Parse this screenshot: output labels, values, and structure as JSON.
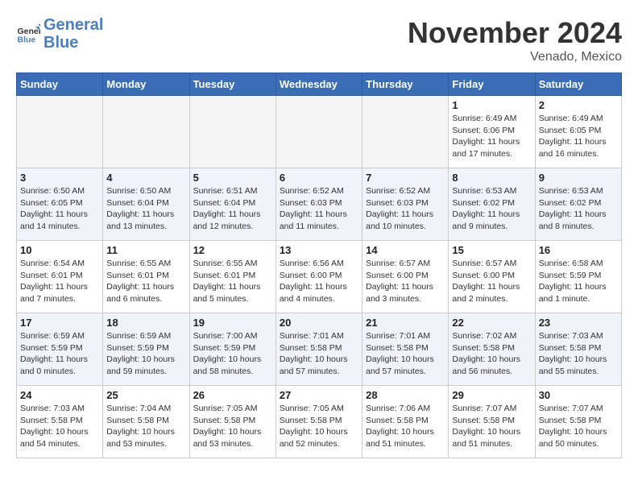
{
  "header": {
    "logo_general": "General",
    "logo_blue": "Blue",
    "month_title": "November 2024",
    "location": "Venado, Mexico"
  },
  "weekdays": [
    "Sunday",
    "Monday",
    "Tuesday",
    "Wednesday",
    "Thursday",
    "Friday",
    "Saturday"
  ],
  "weeks": [
    [
      {
        "day": "",
        "info": ""
      },
      {
        "day": "",
        "info": ""
      },
      {
        "day": "",
        "info": ""
      },
      {
        "day": "",
        "info": ""
      },
      {
        "day": "",
        "info": ""
      },
      {
        "day": "1",
        "info": "Sunrise: 6:49 AM\nSunset: 6:06 PM\nDaylight: 11 hours and 17 minutes."
      },
      {
        "day": "2",
        "info": "Sunrise: 6:49 AM\nSunset: 6:05 PM\nDaylight: 11 hours and 16 minutes."
      }
    ],
    [
      {
        "day": "3",
        "info": "Sunrise: 6:50 AM\nSunset: 6:05 PM\nDaylight: 11 hours and 14 minutes."
      },
      {
        "day": "4",
        "info": "Sunrise: 6:50 AM\nSunset: 6:04 PM\nDaylight: 11 hours and 13 minutes."
      },
      {
        "day": "5",
        "info": "Sunrise: 6:51 AM\nSunset: 6:04 PM\nDaylight: 11 hours and 12 minutes."
      },
      {
        "day": "6",
        "info": "Sunrise: 6:52 AM\nSunset: 6:03 PM\nDaylight: 11 hours and 11 minutes."
      },
      {
        "day": "7",
        "info": "Sunrise: 6:52 AM\nSunset: 6:03 PM\nDaylight: 11 hours and 10 minutes."
      },
      {
        "day": "8",
        "info": "Sunrise: 6:53 AM\nSunset: 6:02 PM\nDaylight: 11 hours and 9 minutes."
      },
      {
        "day": "9",
        "info": "Sunrise: 6:53 AM\nSunset: 6:02 PM\nDaylight: 11 hours and 8 minutes."
      }
    ],
    [
      {
        "day": "10",
        "info": "Sunrise: 6:54 AM\nSunset: 6:01 PM\nDaylight: 11 hours and 7 minutes."
      },
      {
        "day": "11",
        "info": "Sunrise: 6:55 AM\nSunset: 6:01 PM\nDaylight: 11 hours and 6 minutes."
      },
      {
        "day": "12",
        "info": "Sunrise: 6:55 AM\nSunset: 6:01 PM\nDaylight: 11 hours and 5 minutes."
      },
      {
        "day": "13",
        "info": "Sunrise: 6:56 AM\nSunset: 6:00 PM\nDaylight: 11 hours and 4 minutes."
      },
      {
        "day": "14",
        "info": "Sunrise: 6:57 AM\nSunset: 6:00 PM\nDaylight: 11 hours and 3 minutes."
      },
      {
        "day": "15",
        "info": "Sunrise: 6:57 AM\nSunset: 6:00 PM\nDaylight: 11 hours and 2 minutes."
      },
      {
        "day": "16",
        "info": "Sunrise: 6:58 AM\nSunset: 5:59 PM\nDaylight: 11 hours and 1 minute."
      }
    ],
    [
      {
        "day": "17",
        "info": "Sunrise: 6:59 AM\nSunset: 5:59 PM\nDaylight: 11 hours and 0 minutes."
      },
      {
        "day": "18",
        "info": "Sunrise: 6:59 AM\nSunset: 5:59 PM\nDaylight: 10 hours and 59 minutes."
      },
      {
        "day": "19",
        "info": "Sunrise: 7:00 AM\nSunset: 5:59 PM\nDaylight: 10 hours and 58 minutes."
      },
      {
        "day": "20",
        "info": "Sunrise: 7:01 AM\nSunset: 5:58 PM\nDaylight: 10 hours and 57 minutes."
      },
      {
        "day": "21",
        "info": "Sunrise: 7:01 AM\nSunset: 5:58 PM\nDaylight: 10 hours and 57 minutes."
      },
      {
        "day": "22",
        "info": "Sunrise: 7:02 AM\nSunset: 5:58 PM\nDaylight: 10 hours and 56 minutes."
      },
      {
        "day": "23",
        "info": "Sunrise: 7:03 AM\nSunset: 5:58 PM\nDaylight: 10 hours and 55 minutes."
      }
    ],
    [
      {
        "day": "24",
        "info": "Sunrise: 7:03 AM\nSunset: 5:58 PM\nDaylight: 10 hours and 54 minutes."
      },
      {
        "day": "25",
        "info": "Sunrise: 7:04 AM\nSunset: 5:58 PM\nDaylight: 10 hours and 53 minutes."
      },
      {
        "day": "26",
        "info": "Sunrise: 7:05 AM\nSunset: 5:58 PM\nDaylight: 10 hours and 53 minutes."
      },
      {
        "day": "27",
        "info": "Sunrise: 7:05 AM\nSunset: 5:58 PM\nDaylight: 10 hours and 52 minutes."
      },
      {
        "day": "28",
        "info": "Sunrise: 7:06 AM\nSunset: 5:58 PM\nDaylight: 10 hours and 51 minutes."
      },
      {
        "day": "29",
        "info": "Sunrise: 7:07 AM\nSunset: 5:58 PM\nDaylight: 10 hours and 51 minutes."
      },
      {
        "day": "30",
        "info": "Sunrise: 7:07 AM\nSunset: 5:58 PM\nDaylight: 10 hours and 50 minutes."
      }
    ]
  ]
}
